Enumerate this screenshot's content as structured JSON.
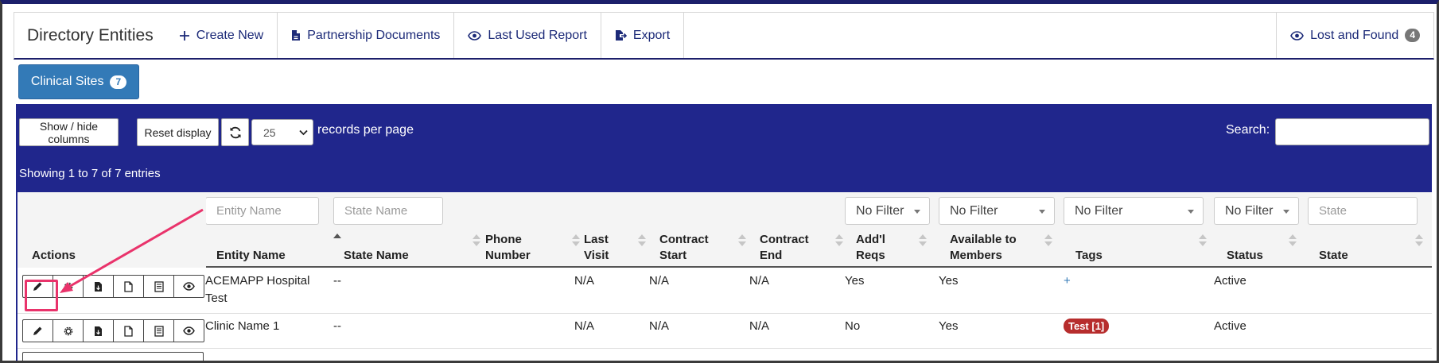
{
  "header": {
    "title": "Directory Entities",
    "nav": [
      {
        "label": "Create New",
        "icon": "plus-icon"
      },
      {
        "label": "Partnership Documents",
        "icon": "file-icon"
      },
      {
        "label": "Last Used Report",
        "icon": "eye-icon"
      },
      {
        "label": "Export",
        "icon": "export-icon"
      }
    ],
    "lost_found": {
      "label": "Lost and Found",
      "count": "4",
      "icon": "eye-icon"
    }
  },
  "entity_tab": {
    "label": "Clinical Sites",
    "count": "7"
  },
  "toolbar": {
    "show_hide_label": "Show / hide columns",
    "reset_label": "Reset display",
    "refresh_icon": "refresh-icon",
    "per_page_value": "25",
    "per_page_label": "records per page",
    "search_label": "Search:",
    "search_value": ""
  },
  "info": "Showing 1 to 7 of 7 entries",
  "filters": {
    "entity_name_placeholder": "Entity Name",
    "state_name_placeholder": "State Name",
    "addl_reqs": "No Filter",
    "available": "No Filter",
    "tags": "No Filter",
    "status": "No Filter",
    "state_placeholder": "State"
  },
  "columns": {
    "actions": "Actions",
    "entity_name": "Entity Name",
    "state_name": "State Name",
    "phone_1": "Phone",
    "phone_2": "Number",
    "visit_1": "Last",
    "visit_2": "Visit",
    "cstart_1": "Contract",
    "cstart_2": "Start",
    "cend_1": "Contract",
    "cend_2": "End",
    "addl_1": "Add'l",
    "addl_2": "Reqs",
    "avail_1": "Available to",
    "avail_2": "Members",
    "tags": "Tags",
    "status": "Status",
    "state": "State"
  },
  "rows": [
    {
      "name_1": "ACEMAPP Hospital",
      "name_2": "Test",
      "state_name": "--",
      "phone": "",
      "last_visit": "N/A",
      "contract_start": "N/A",
      "contract_end": "N/A",
      "addl_reqs": "Yes",
      "available": "Yes",
      "tags": "+",
      "status": "Active",
      "state": ""
    },
    {
      "name_1": "Clinic Name 1",
      "name_2": "",
      "state_name": "--",
      "phone": "",
      "last_visit": "N/A",
      "contract_start": "N/A",
      "contract_end": "N/A",
      "addl_reqs": "No",
      "available": "Yes",
      "tags": "Test [1]",
      "status": "Active",
      "state": ""
    }
  ],
  "action_icons": [
    "pencil-icon",
    "gear-icon",
    "file-download-icon",
    "document-icon",
    "list-icon",
    "eye-icon"
  ],
  "colors": {
    "panel": "#20268c",
    "tab": "#337ab7",
    "highlight": "#e9336b",
    "tag_red": "#b72d2d"
  }
}
